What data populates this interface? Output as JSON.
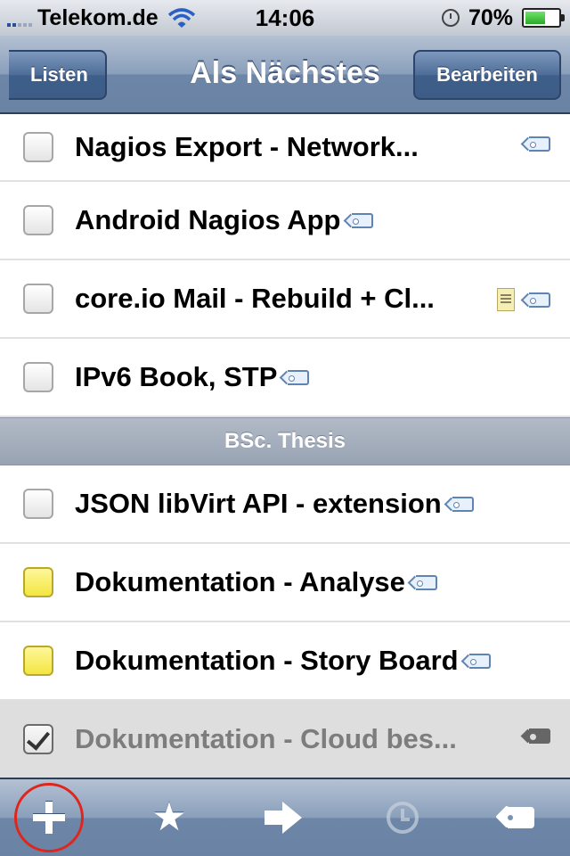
{
  "status_bar": {
    "carrier": "Telekom.de",
    "time": "14:06",
    "battery": "70%",
    "battery_level": 0.7
  },
  "nav": {
    "back_label": "Listen",
    "title": "Als Nächstes",
    "edit_label": "Bearbeiten"
  },
  "tasks_top": [
    {
      "title": "Nagios Export - Network...",
      "checkbox": "empty"
    },
    {
      "title": "Android Nagios App",
      "checkbox": "empty"
    },
    {
      "title": "core.io Mail - Rebuild + Cl...",
      "checkbox": "empty"
    },
    {
      "title": "IPv6 Book, STP",
      "checkbox": "empty"
    }
  ],
  "section": {
    "label": "BSc. Thesis"
  },
  "tasks_thesis": [
    {
      "title": "JSON libVirt API - extension",
      "checkbox": "empty"
    },
    {
      "title": "Dokumentation - Analyse",
      "checkbox": "yellow"
    },
    {
      "title": "Dokumentation - Story Board",
      "checkbox": "yellow"
    },
    {
      "title": "Dokumentation - Cloud bes...",
      "checkbox": "checked"
    }
  ],
  "toolbar": {
    "items": [
      "plus-icon",
      "star-icon",
      "arrow-right-icon",
      "alarm-clock-icon",
      "tag-icon"
    ]
  },
  "colors": {
    "highlight_circle": "#e0261c",
    "yellow_checkbox": "#f2e640"
  }
}
